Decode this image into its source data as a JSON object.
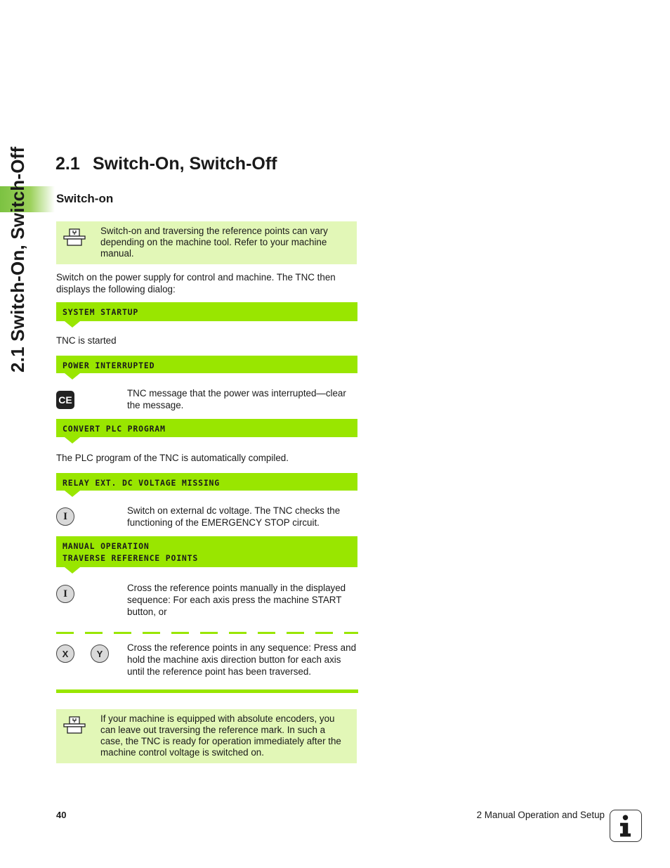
{
  "side_tab": {
    "title": "2.1 Switch-On, Switch-Off",
    "accent": "#7cc242"
  },
  "heading": {
    "number": "2.1",
    "title": "Switch-On, Switch-Off"
  },
  "subheading": "Switch-on",
  "notes": [
    {
      "icon": "machine-tool-icon",
      "text": "Switch-on and traversing the reference points can vary depending on the machine tool. Refer to your machine manual."
    },
    {
      "icon": "machine-tool-icon",
      "text": "If your machine is equipped with absolute encoders, you can leave out traversing the reference mark. In such a case, the TNC is ready for operation immediately after the machine control voltage is switched on."
    }
  ],
  "intro": "Switch on the power supply for control and machine. The TNC then displays the following dialog:",
  "dialogs": [
    {
      "lines": [
        "SYSTEM STARTUP"
      ]
    },
    {
      "lines": [
        "POWER INTERRUPTED"
      ]
    },
    {
      "lines": [
        "CONVERT PLC PROGRAM"
      ]
    },
    {
      "lines": [
        "RELAY EXT. DC VOLTAGE MISSING"
      ]
    },
    {
      "lines": [
        "MANUAL OPERATION",
        "TRAVERSE REFERENCE POINTS"
      ]
    }
  ],
  "steps": {
    "tnc_started": "TNC is started",
    "ce": {
      "key": "CE",
      "text": "TNC message that the power was interrupted—clear the message."
    },
    "plc": "The PLC program of the TNC is automatically compiled.",
    "dc": {
      "key": "I",
      "text": "Switch on external dc voltage. The TNC checks the functioning of the EMERGENCY STOP circuit."
    },
    "manual": {
      "key": "I",
      "text": "Cross the reference points manually in the displayed sequence: For each axis press the machine START button, or"
    },
    "axis": {
      "keys": [
        "X",
        "Y"
      ],
      "text": "Cross the reference points in any sequence: Press and hold the machine axis direction button for each axis until the reference point has been traversed."
    }
  },
  "colors": {
    "dialog_green": "#99e600",
    "note_bg": "#e2f7b7"
  },
  "footer": {
    "page": "40",
    "chapter": "2 Manual Operation and Setup",
    "icon": "info-icon"
  }
}
